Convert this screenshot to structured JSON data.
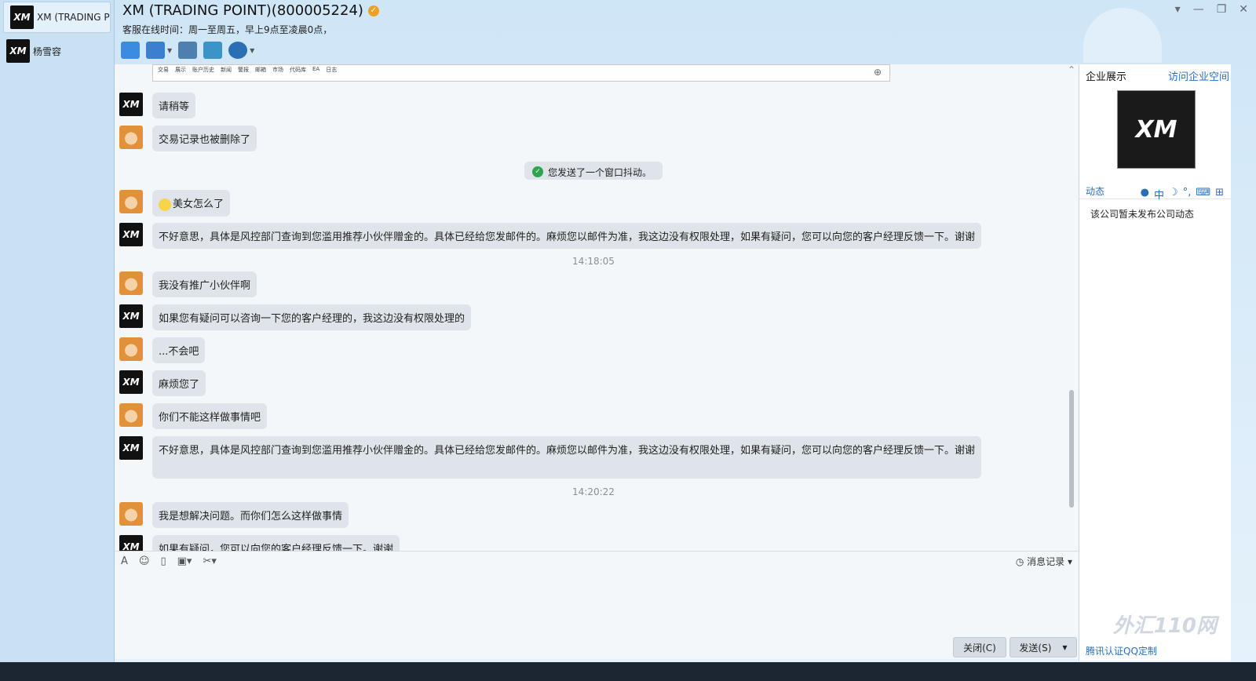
{
  "sidebar": {
    "contacts": [
      {
        "name": "XM (TRADING PO",
        "avatar": "XM"
      },
      {
        "name": "杨雪容",
        "avatar": "XM"
      }
    ]
  },
  "header": {
    "title": "XM (TRADING POINT)(800005224)",
    "service_hours": "客服在线时间：周一至周五，早上9点至凌晨0点，"
  },
  "chat": {
    "strip_tabs": [
      "交易",
      "展示",
      "账户历史",
      "新闻",
      "警报",
      "邮箱",
      "市场",
      "代码库",
      "EA",
      "日志"
    ],
    "messages": [
      {
        "from": "xm",
        "text": "请稍等"
      },
      {
        "from": "user",
        "text": "交易记录也被删除了"
      },
      {
        "from": "system",
        "text": "您发送了一个窗口抖动。"
      },
      {
        "from": "user",
        "text": "美女怎么了"
      },
      {
        "from": "xm",
        "text": "不好意思，具体是风控部门查询到您滥用推荐小伙伴赠金的。具体已经给您发邮件的。麻烦您以邮件为准，我这边没有权限处理，如果有疑问，您可以向您的客户经理反馈一下。谢谢"
      },
      {
        "from": "time",
        "text": "14:18:05"
      },
      {
        "from": "user",
        "text": "我没有推广小伙伴啊"
      },
      {
        "from": "xm",
        "text": "如果您有疑问可以咨询一下您的客户经理的，我这边没有权限处理的"
      },
      {
        "from": "user",
        "text": "...不会吧"
      },
      {
        "from": "xm",
        "text": "麻烦您了"
      },
      {
        "from": "user",
        "text": "你们不能这样做事情吧"
      },
      {
        "from": "xm",
        "text": "不好意思，具体是风控部门查询到您滥用推荐小伙伴赠金的。具体已经给您发邮件的。麻烦您以邮件为准，我这边没有权限处理，如果有疑问，您可以向您的客户经理反馈一下。谢谢"
      },
      {
        "from": "time",
        "text": "14:20:22"
      },
      {
        "from": "user",
        "text": "我是想解决问题。而你们怎么这样做事情"
      },
      {
        "from": "xm",
        "text": "如果有疑问，您可以向您的客户经理反馈一下。谢谢"
      }
    ]
  },
  "input": {
    "history_label": "消息记录",
    "close_label": "关闭(C)",
    "send_label": "发送(S)"
  },
  "right_panel": {
    "title": "企业展示",
    "link": "访问企业空间",
    "logo_text": "XM",
    "tab": "动态",
    "ime_label": "中",
    "empty_text": "该公司暂未发布公司动态",
    "footer": "腾讯认证QQ定制",
    "watermark": "外汇110网"
  }
}
